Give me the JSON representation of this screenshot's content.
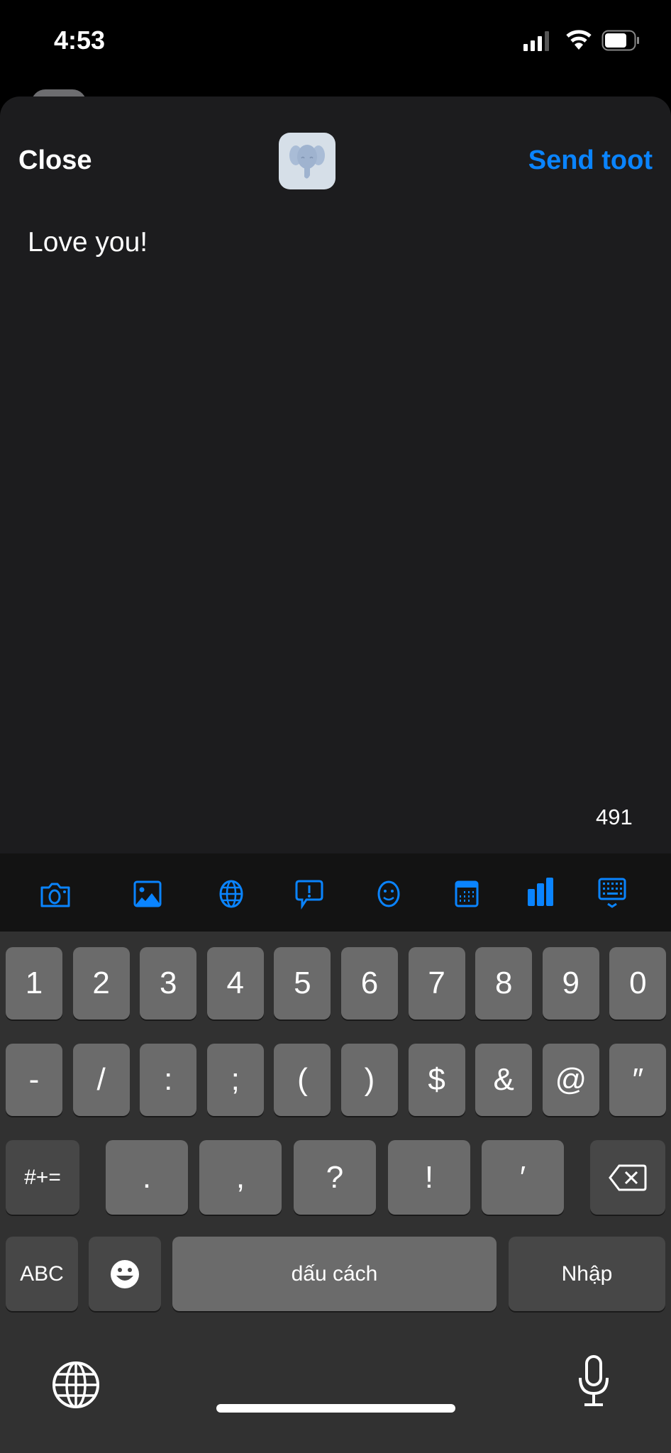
{
  "status_bar": {
    "time": "4:53",
    "signal": "4 bars",
    "wifi": "full",
    "battery_level": 0.75
  },
  "header": {
    "close_label": "Close",
    "send_label": "Send toot",
    "avatar": "mastodon-elephant"
  },
  "compose": {
    "text": "Love you!",
    "remaining_chars": "491"
  },
  "accent_color": "#0a84ff",
  "toolbar": {
    "icons": [
      "camera-icon",
      "photo-icon",
      "globe-icon",
      "content-warning-icon",
      "emoji-icon",
      "calendar-icon",
      "poll-icon",
      "keyboard-dismiss-icon"
    ]
  },
  "keyboard": {
    "row1": [
      "1",
      "2",
      "3",
      "4",
      "5",
      "6",
      "7",
      "8",
      "9",
      "0"
    ],
    "row2": [
      "-",
      "/",
      ":",
      ";",
      "(",
      ")",
      "$",
      "&",
      "@",
      "″"
    ],
    "row3": {
      "mode": "#+=",
      "keys": [
        ".",
        ",",
        "?",
        "!",
        "′"
      ]
    },
    "row4": {
      "abc": "ABC",
      "space": "dấu cách",
      "return": "Nhập"
    }
  }
}
